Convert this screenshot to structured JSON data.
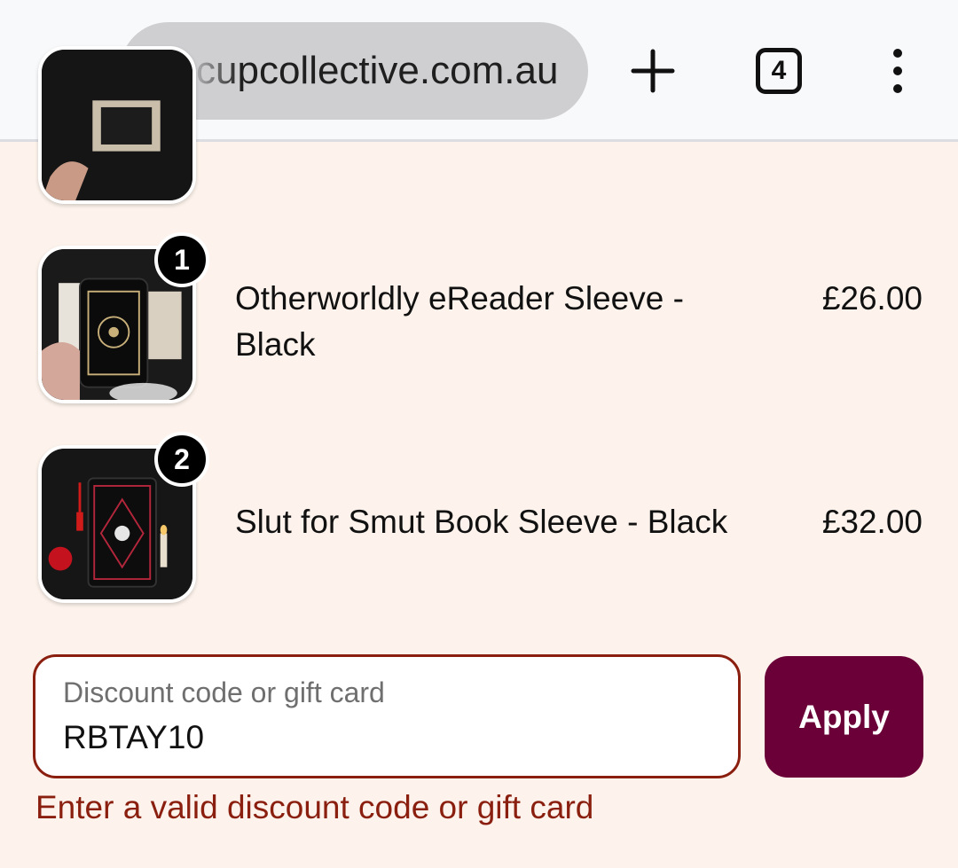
{
  "browser": {
    "url": "cupcollective.com.au",
    "tab_count": "4"
  },
  "cart": {
    "items": [
      {
        "name": "",
        "price": "",
        "quantity": ""
      },
      {
        "name": "Otherworldly eReader Sleeve - Black",
        "price": "£26.00",
        "quantity": "1"
      },
      {
        "name": "Slut for Smut Book Sleeve - Black",
        "price": "£32.00",
        "quantity": "2"
      }
    ]
  },
  "discount": {
    "label": "Discount code or gift card",
    "value": "RBTAY10",
    "apply_label": "Apply",
    "error": "Enter a valid discount code or gift card"
  },
  "colors": {
    "page_background": "#fdf3ec",
    "apply_button": "#6b0038",
    "error_text": "#8a1f0f"
  }
}
